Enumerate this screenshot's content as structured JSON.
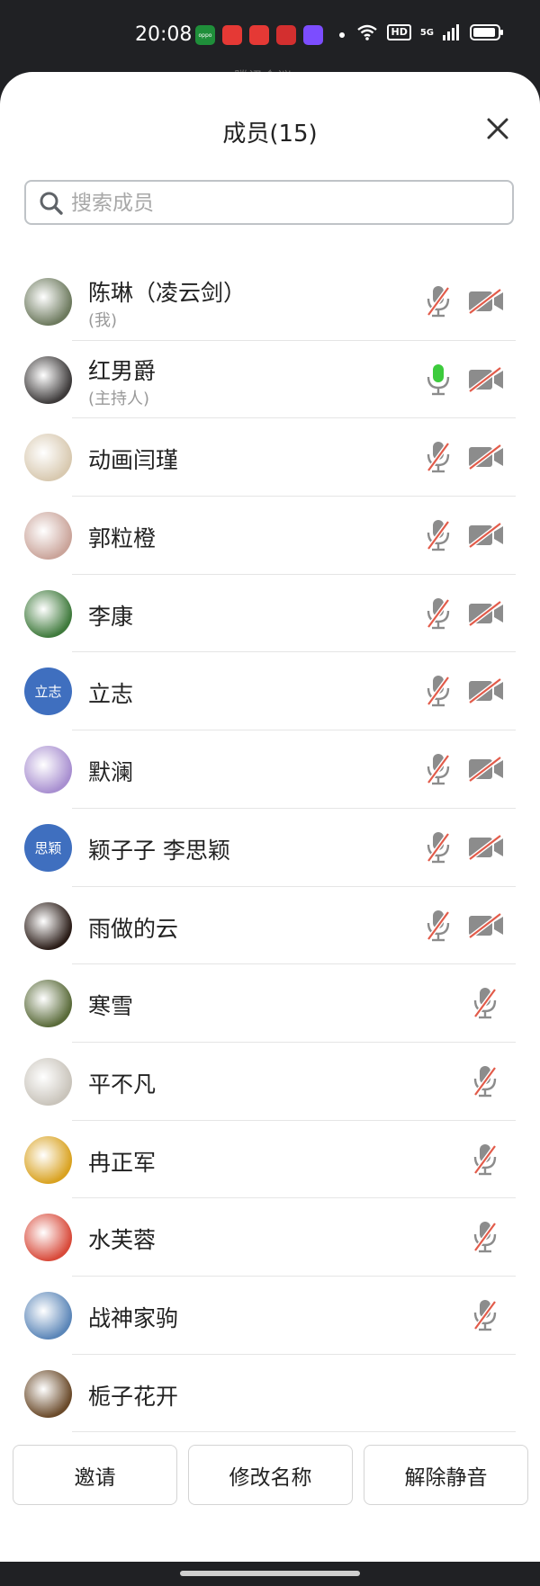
{
  "status_bar": {
    "time": "20:08",
    "apps": [
      {
        "icon": "oppo-app-icon",
        "label": "oppo",
        "color": "#1f8f3a"
      },
      {
        "icon": "video-app-icon",
        "label": "",
        "color": "#e53935"
      },
      {
        "icon": "shop-app-icon",
        "label": "",
        "color": "#e53935"
      },
      {
        "icon": "red-app-icon",
        "label": "",
        "color": "#d32f2f"
      },
      {
        "icon": "gallery-app-icon",
        "label": "",
        "color": "#7c4dff"
      }
    ],
    "hd": "HD",
    "signal": "5G"
  },
  "panel": {
    "peek_title": "腾讯会议",
    "title": "成员(15)"
  },
  "search": {
    "placeholder": "搜索成员"
  },
  "members": [
    {
      "name": "陈琳（凌云剑）",
      "role": "(我)",
      "avatar_type": "photo",
      "avatar_color": "#6d7a5e",
      "avatar_text": "",
      "mic": "muted",
      "video": "off"
    },
    {
      "name": "红男爵",
      "role": "(主持人)",
      "avatar_type": "photo",
      "avatar_color": "#3d3a3a",
      "avatar_text": "",
      "mic": "active",
      "video": "off"
    },
    {
      "name": "动画闫瑾",
      "role": "",
      "avatar_type": "photo",
      "avatar_color": "#d8c9b0",
      "avatar_text": "",
      "mic": "muted",
      "video": "off"
    },
    {
      "name": "郭粒橙",
      "role": "",
      "avatar_type": "photo",
      "avatar_color": "#caa49a",
      "avatar_text": "",
      "mic": "muted",
      "video": "off"
    },
    {
      "name": "李康",
      "role": "",
      "avatar_type": "photo",
      "avatar_color": "#3f7a3c",
      "avatar_text": "",
      "mic": "muted",
      "video": "off"
    },
    {
      "name": "立志",
      "role": "",
      "avatar_type": "text",
      "avatar_color": "#3f6fbf",
      "avatar_text": "立志",
      "mic": "muted",
      "video": "off"
    },
    {
      "name": "默澜",
      "role": "",
      "avatar_type": "photo",
      "avatar_color": "#a88fd0",
      "avatar_text": "",
      "mic": "muted",
      "video": "off"
    },
    {
      "name": "颖子子  李思颖",
      "role": "",
      "avatar_type": "text",
      "avatar_color": "#3f6fbf",
      "avatar_text": "思颖",
      "mic": "muted",
      "video": "off"
    },
    {
      "name": "雨做的云",
      "role": "",
      "avatar_type": "photo",
      "avatar_color": "#2b1d18",
      "avatar_text": "",
      "mic": "muted",
      "video": "off"
    },
    {
      "name": "寒雪",
      "role": "",
      "avatar_type": "photo",
      "avatar_color": "#5a6b3a",
      "avatar_text": "",
      "mic": "muted",
      "video": "none"
    },
    {
      "name": "平不凡",
      "role": "",
      "avatar_type": "photo",
      "avatar_color": "#c9c4bb",
      "avatar_text": "",
      "mic": "muted",
      "video": "none"
    },
    {
      "name": "冉正军",
      "role": "",
      "avatar_type": "photo",
      "avatar_color": "#d9a220",
      "avatar_text": "",
      "mic": "muted",
      "video": "none"
    },
    {
      "name": "水芙蓉",
      "role": "",
      "avatar_type": "photo",
      "avatar_color": "#d84a3a",
      "avatar_text": "",
      "mic": "muted",
      "video": "none"
    },
    {
      "name": "战神家驹",
      "role": "",
      "avatar_type": "photo",
      "avatar_color": "#5b86b8",
      "avatar_text": "",
      "mic": "muted",
      "video": "none"
    },
    {
      "name": "栀子花开",
      "role": "",
      "avatar_type": "photo",
      "avatar_color": "#6a4a2a",
      "avatar_text": "",
      "mic": "none",
      "video": "none"
    }
  ],
  "footer": {
    "invite": "邀请",
    "rename": "修改名称",
    "unmute": "解除静音"
  },
  "colors": {
    "muted_slash": "#e25b4a",
    "icon_gray": "#8c8c8c",
    "mic_active": "#3ccb3c"
  }
}
